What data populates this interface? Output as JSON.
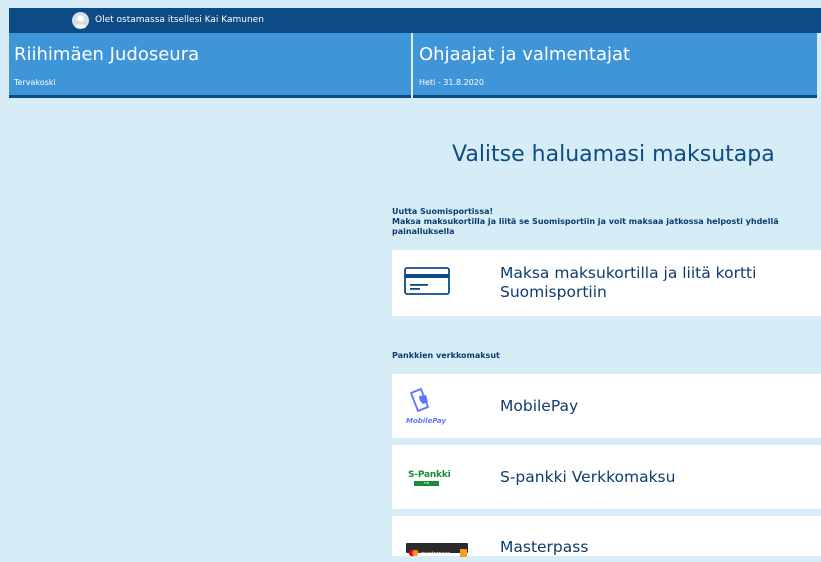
{
  "topbar": {
    "user_text": "Olet ostamassa itsellesi Kai Kamunen"
  },
  "club": {
    "name": "Riihimäen Judoseura",
    "location": "Tervakoski"
  },
  "product": {
    "name": "Ohjaajat ja valmentajat",
    "period": "Heti - 31.8.2020"
  },
  "main": {
    "title": "Valitse haluamasi maksutapa",
    "promo": {
      "line1": "Uutta Suomisportissa!",
      "line2": "Maksa maksukortilla ja liitä se Suomisportiin ja voit maksaa jatkossa helposti yhdellä",
      "line3": "painalluksella"
    },
    "card_option": {
      "line1": "Maksa maksukortilla ja liitä kortti",
      "line2": "Suomisportiin",
      "icon": "credit-card-icon"
    },
    "bank_section_title": "Pankkien verkkomaksut",
    "bank_options": [
      {
        "label": "MobilePay",
        "logo_text": "MobilePay",
        "icon": "mobilepay-logo"
      },
      {
        "label": "S-pankki Verkkomaksu",
        "logo_text": "S-Pankki",
        "logo_subtext": "FTB",
        "icon": "s-pankki-logo"
      },
      {
        "label": "Masterpass",
        "logo_text": "masterpass",
        "icon": "masterpass-logo"
      }
    ]
  },
  "colors": {
    "background": "#d6edf7",
    "topbar": "#0d4b87",
    "panel": "#3e95d8",
    "text_dark": "#0d3d6e",
    "mobilepay_blue": "#5a78ff",
    "spankki_green": "#1c8a3a"
  }
}
